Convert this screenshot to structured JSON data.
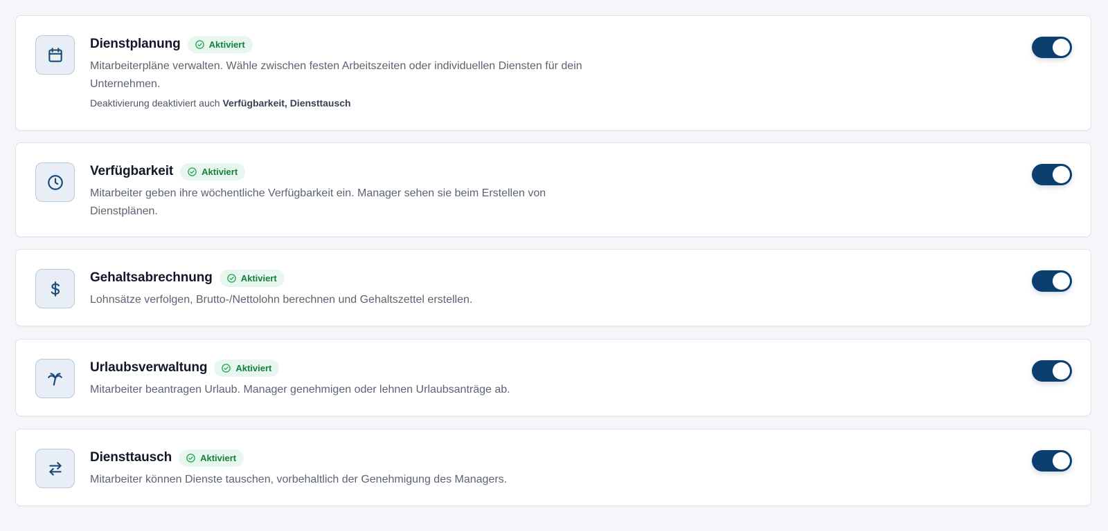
{
  "features": [
    {
      "title": "Dienstplanung",
      "badge": "Aktiviert",
      "description_line1": "Mitarbeiterpläne verwalten. Wähle zwischen festen Arbeitszeiten oder individuellen Diensten für dein",
      "description_line2": "Unternehmen.",
      "note_prefix": "Deaktivierung deaktiviert auch",
      "note_strong": "Verfügbarkeit, Diensttausch",
      "icon": "calendar-icon",
      "enabled": true
    },
    {
      "title": "Verfügbarkeit",
      "badge": "Aktiviert",
      "description_line1": "Mitarbeiter geben ihre wöchentliche Verfügbarkeit ein. Manager sehen sie beim Erstellen von",
      "description_line2": "Dienstplänen.",
      "icon": "clock-icon",
      "enabled": true
    },
    {
      "title": "Gehaltsabrechnung",
      "badge": "Aktiviert",
      "description_line1": "Lohnsätze verfolgen, Brutto-/Nettolohn berechnen und Gehaltszettel erstellen.",
      "icon": "dollar-icon",
      "enabled": true
    },
    {
      "title": "Urlaubsverwaltung",
      "badge": "Aktiviert",
      "description_line1": "Mitarbeiter beantragen Urlaub. Manager genehmigen oder lehnen Urlaubsanträge ab.",
      "icon": "palm-tree-icon",
      "enabled": true
    },
    {
      "title": "Diensttausch",
      "badge": "Aktiviert",
      "description_line1": "Mitarbeiter können Dienste tauschen, vorbehaltlich der Genehmigung des Managers.",
      "icon": "swap-arrows-icon",
      "enabled": true
    }
  ],
  "colors": {
    "accent": "#0c3e6e",
    "badge_bg": "#e7f6ee",
    "badge_text": "#15803d",
    "icon_bg": "#e8eef5"
  }
}
